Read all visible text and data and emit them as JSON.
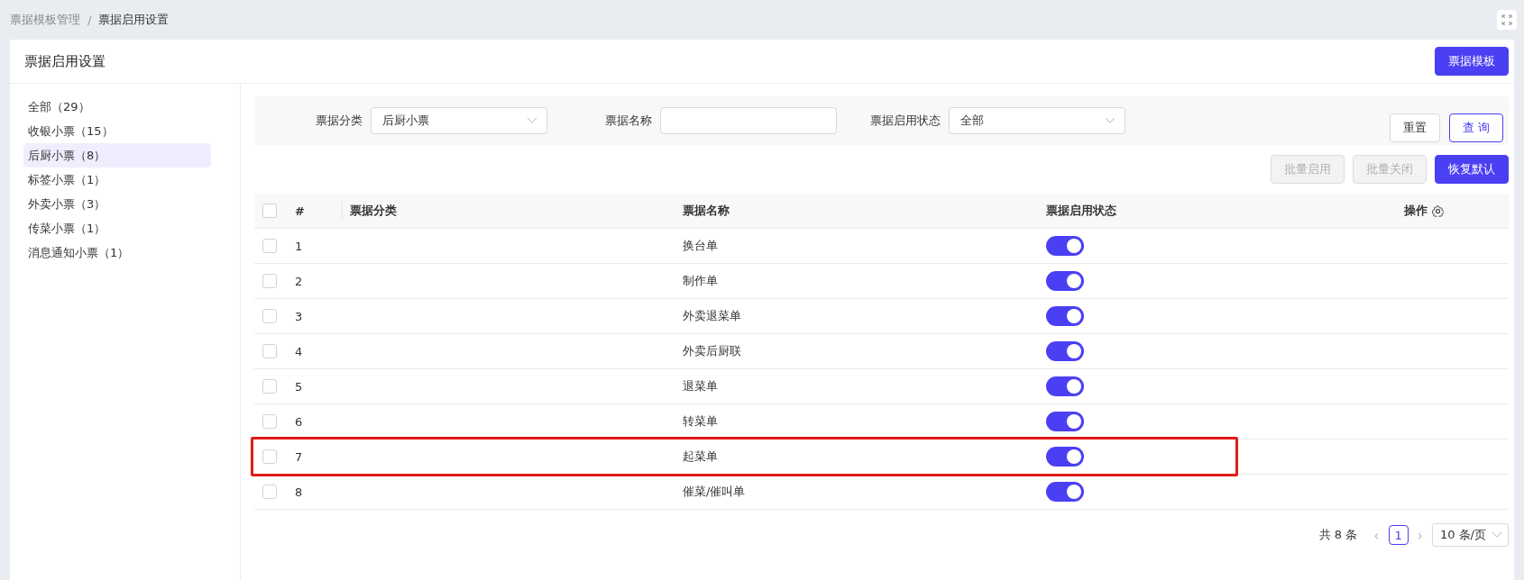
{
  "breadcrumb": [
    {
      "label": "票据模板管理",
      "current": false
    },
    {
      "label": "票据启用设置",
      "current": true
    }
  ],
  "breadcrumb_separator": "/",
  "page_title": "票据启用设置",
  "header_button": "票据模板",
  "sidebar": {
    "items": [
      {
        "label": "全部（29）",
        "selected": false
      },
      {
        "label": "收银小票（15）",
        "selected": false
      },
      {
        "label": "后厨小票（8）",
        "selected": true
      },
      {
        "label": "标签小票（1）",
        "selected": false
      },
      {
        "label": "外卖小票（3）",
        "selected": false
      },
      {
        "label": "传菜小票（1）",
        "selected": false
      },
      {
        "label": "消息通知小票（1）",
        "selected": false
      }
    ]
  },
  "filters": [
    {
      "label": "票据分类",
      "kind": "select",
      "value": "后厨小票"
    },
    {
      "label": "票据名称",
      "kind": "input"
    },
    {
      "label": "票据启用状态",
      "kind": "select",
      "value": "全部"
    }
  ],
  "filter_buttons": [
    {
      "label": "重置",
      "primary": false
    },
    {
      "label": "查 询",
      "primary": true
    }
  ],
  "bulk_buttons": [
    {
      "label": "批量启用",
      "disabled": true
    },
    {
      "label": "批量关闭",
      "disabled": true
    },
    {
      "label": "恢复默认",
      "disabled": false
    }
  ],
  "table": {
    "columns": [
      "#",
      "票据分类",
      "票据名称",
      "票据启用状态",
      "操作"
    ],
    "header_checked": false,
    "rows": [
      {
        "index": "1",
        "name": "换台单",
        "enabled": true,
        "checked": false,
        "highlighted": false
      },
      {
        "index": "2",
        "name": "制作单",
        "enabled": true,
        "checked": false,
        "highlighted": false
      },
      {
        "index": "3",
        "name": "外卖退菜单",
        "enabled": true,
        "checked": false,
        "highlighted": false
      },
      {
        "index": "4",
        "name": "外卖后厨联",
        "enabled": true,
        "checked": false,
        "highlighted": false
      },
      {
        "index": "5",
        "name": "退菜单",
        "enabled": true,
        "checked": false,
        "highlighted": false
      },
      {
        "index": "6",
        "name": "转菜单",
        "enabled": true,
        "checked": false,
        "highlighted": false
      },
      {
        "index": "7",
        "name": "起菜单",
        "enabled": true,
        "checked": false,
        "highlighted": true
      },
      {
        "index": "8",
        "name": "催菜/催叫单",
        "enabled": true,
        "checked": false,
        "highlighted": false
      }
    ]
  },
  "pagination": {
    "total": "共 8 条",
    "prev": "‹",
    "next": "›",
    "pages": [
      {
        "label": "1",
        "selected": true
      }
    ],
    "page_size": "10 条/页"
  }
}
